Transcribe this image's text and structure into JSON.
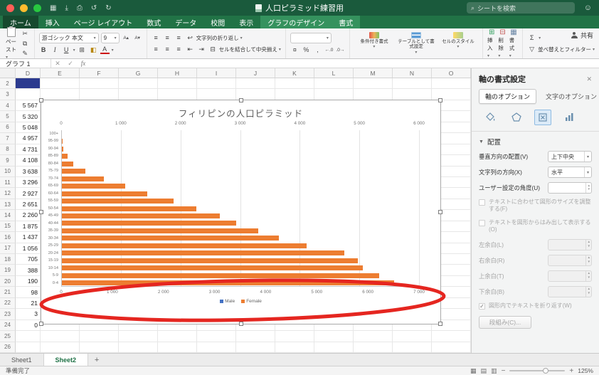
{
  "titlebar": {
    "title": "人口ピラミッド練習用",
    "search_placeholder": "シートを検索",
    "traffic_colors": [
      "#ff5f57",
      "#febc2e",
      "#28c840"
    ]
  },
  "tabs": {
    "items": [
      "ホーム",
      "挿入",
      "ページ レイアウト",
      "数式",
      "データ",
      "校閲",
      "表示",
      "グラフのデザイン",
      "書式"
    ],
    "active": "ホーム",
    "contextual": [
      "グラフのデザイン",
      "書式"
    ],
    "share_label": "共有"
  },
  "ribbon": {
    "paste": "ペースト",
    "font_name": "游ゴシック 本文",
    "font_size": "9",
    "bold": "B",
    "italic": "I",
    "underline": "U",
    "wrap_text": "文字列の折り返し",
    "merge_center": "セルを結合して中央揃え",
    "number_format": "",
    "conditional": "条件付き書式",
    "format_table": "テーブルとして書式設定",
    "cell_styles": "セルのスタイル",
    "insert": "挿入",
    "delete": "削除",
    "format": "書式",
    "sort_filter": "並べ替えとフィルター"
  },
  "formula_bar": {
    "name_box": "グラフ 1",
    "fx": "fx"
  },
  "grid": {
    "col_headers": [
      "D",
      "E",
      "F",
      "G",
      "H",
      "I",
      "J",
      "K",
      "L",
      "M",
      "N",
      "O"
    ],
    "row_start": 2,
    "row_end": 26,
    "d_values": {
      "4": "5 567",
      "5": "5 320",
      "6": "5 048",
      "7": "4 957",
      "8": "4 731",
      "9": "4 108",
      "10": "3 638",
      "11": "3 296",
      "12": "2 927",
      "13": "2 651",
      "14": "2 260",
      "15": "1 875",
      "16": "1 437",
      "17": "1 056",
      "18": "705",
      "19": "388",
      "20": "190",
      "21": "98",
      "22": "21",
      "23": "3",
      "24": "0"
    },
    "selected_cell": {
      "row": 2,
      "col": "D",
      "fill": "#2b3a8f"
    }
  },
  "chart_data": {
    "type": "bar",
    "orientation": "horizontal",
    "title": "フィリピンの人口ピラミッド",
    "categories": [
      "100+",
      "95-99",
      "90-94",
      "85-89",
      "80-84",
      "75-79",
      "70-74",
      "65-69",
      "60-64",
      "55-59",
      "50-54",
      "45-49",
      "40-44",
      "35-39",
      "30-34",
      "25-29",
      "20-24",
      "15-19",
      "10-14",
      "5-9",
      "0-4"
    ],
    "values": [
      0,
      3,
      21,
      98,
      190,
      388,
      705,
      1056,
      1437,
      1875,
      2260,
      2651,
      2927,
      3296,
      3638,
      4108,
      4731,
      4957,
      5048,
      5320,
      5567
    ],
    "bar_color": "#ED7D31",
    "legend": [
      {
        "label": "Male",
        "color": "#4472C4"
      },
      {
        "label": "Female",
        "color": "#ED7D31"
      }
    ],
    "axis_top": {
      "min": 0,
      "max": 6000,
      "step": 1000,
      "tick_labels": [
        "0",
        "1 000",
        "2 000",
        "3 000",
        "4 000",
        "5 000",
        "6 000"
      ]
    },
    "axis_bottom": {
      "min": 0,
      "max": 7000,
      "step": 1000,
      "tick_labels": [
        "0",
        "1 000",
        "2 000",
        "3 000",
        "4 000",
        "5 000",
        "6 000",
        "7 000"
      ]
    },
    "gridlines": true
  },
  "annotation": {
    "shape": "ellipse",
    "color": "#e52620"
  },
  "panel": {
    "title": "軸の書式設定",
    "tabs": [
      "軸のオプション",
      "文字のオプション"
    ],
    "active_tab": "軸のオプション",
    "section": "配置",
    "fields": [
      {
        "label": "垂直方向の配置(V)",
        "value": "上下中央",
        "type": "dropdown"
      },
      {
        "label": "文字列の方向(X)",
        "value": "水平",
        "type": "dropdown"
      },
      {
        "label": "ユーザー設定の角度(U)",
        "value": "",
        "type": "spinner"
      }
    ],
    "checkboxes": [
      {
        "label": "テキストに合わせて図形のサイズを調整する(F)",
        "checked": false,
        "enabled": false
      },
      {
        "label": "テキストを図形からはみ出して表示する(O)",
        "checked": false,
        "enabled": false
      }
    ],
    "margins": [
      {
        "label": "左余白(L)",
        "value": ""
      },
      {
        "label": "右余白(R)",
        "value": ""
      },
      {
        "label": "上余白(T)",
        "value": ""
      },
      {
        "label": "下余白(B)",
        "value": ""
      }
    ],
    "wrap_checkbox": {
      "label": "図形内でテキストを折り返す(W)",
      "checked": true,
      "enabled": false
    },
    "columns_button": "段組み(C)..."
  },
  "sheet_tabs": {
    "items": [
      "Sheet1",
      "Sheet2"
    ],
    "active": "Sheet2"
  },
  "status_bar": {
    "ready": "準備完了",
    "zoom": "125%"
  },
  "icons": {
    "caret": "▾",
    "search": "⌕",
    "cut": "✂",
    "copy": "⧉",
    "paint": "✎",
    "borders": "⊞",
    "fill": "◧",
    "font_color_letter": "A",
    "font_up": "A▴",
    "font_down": "A▾",
    "align": "≡",
    "indent_left": "⇤",
    "indent_right": "⇥",
    "wrap": "↩",
    "merge": "⊟",
    "currency": "¤",
    "percent": "%",
    "comma": ",",
    "dec_inc": "←.0",
    "dec_dec": ".0→",
    "autosum": "Σ",
    "funnel": "▽",
    "insert_cells": "⊞",
    "delete_cells": "⊟",
    "format_cells": "▦",
    "close": "✕",
    "check": "✓",
    "plus": "+",
    "minus": "−",
    "smiley": "☺",
    "grid_view": "▦",
    "page_view": "▤",
    "break_view": "▥",
    "apps": "▦",
    "save": "⤓",
    "print": "⎙",
    "undo": "↺",
    "redo": "↻",
    "tri_down": "▼",
    "spin_up": "▴",
    "spin_down": "▾"
  }
}
